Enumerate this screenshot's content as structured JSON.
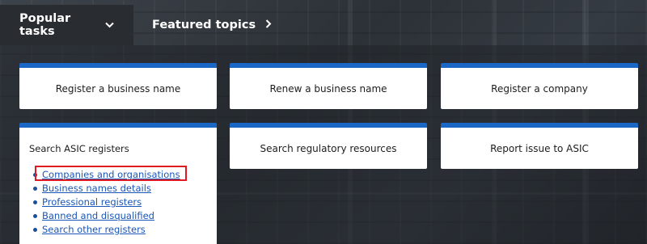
{
  "tabs": {
    "popular": {
      "label": "Popular tasks",
      "icon": "chevron-down-icon"
    },
    "featured": {
      "label": "Featured topics",
      "icon": "chevron-right-icon"
    }
  },
  "cards": {
    "register_business_name": "Register a business name",
    "renew_business_name": "Renew a business name",
    "register_company": "Register a company",
    "search_regulatory": "Search regulatory resources",
    "report_issue": "Report issue to ASIC"
  },
  "search_registers": {
    "title": "Search ASIC registers",
    "links": [
      "Companies and organisations",
      "Business names details",
      "Professional registers",
      "Banned and disqualified",
      "Search other registers"
    ]
  },
  "colors": {
    "accent": "#1a67c6",
    "link": "#1a56b5",
    "highlight": "#e01a22",
    "tab_active_bg": "#292d32"
  }
}
